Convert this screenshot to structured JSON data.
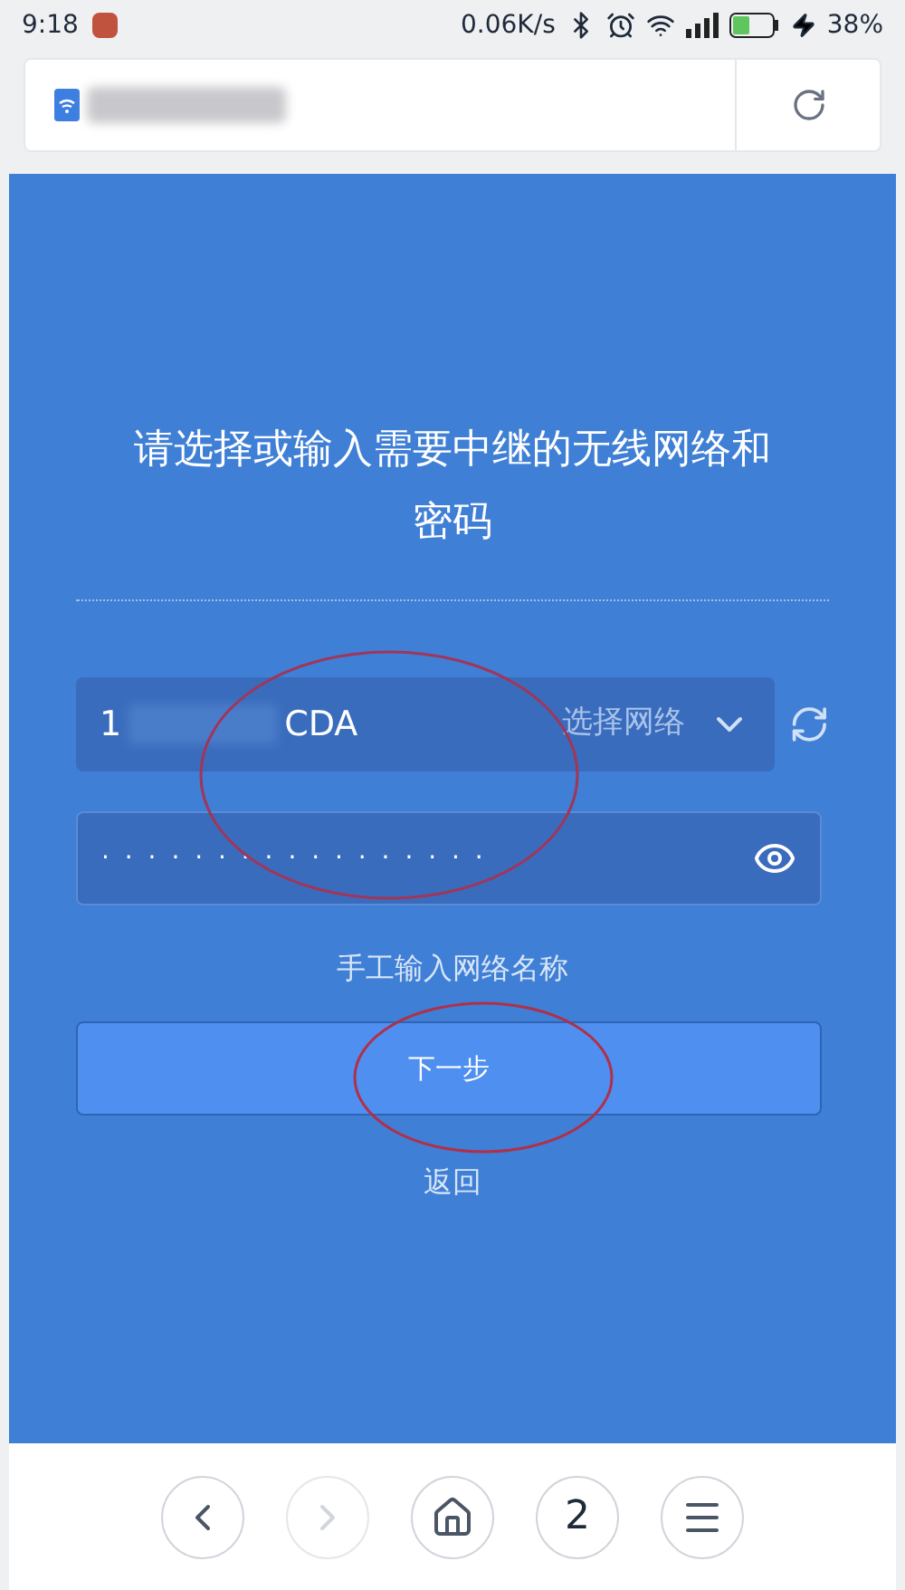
{
  "status_bar": {
    "time": "9:18",
    "speed": "0.06K/s",
    "battery": "38%"
  },
  "title": "请选择或输入需要中继的无线网络和密码",
  "network_field": {
    "value_start": "1",
    "value_end": "CDA",
    "action": "选择网络"
  },
  "password_field": {
    "mask": "· · · · · · · · · · · · · · · · ·"
  },
  "manual_link": "手工输入网络名称",
  "next_button": "下一步",
  "back_link": "返回",
  "bottom_nav": [
    {
      "kind": "back",
      "disabled": false
    },
    {
      "kind": "forward",
      "disabled": true
    },
    {
      "kind": "home",
      "disabled": false
    },
    {
      "kind": "tabs",
      "label": "2",
      "disabled": false
    },
    {
      "kind": "menu",
      "disabled": false
    }
  ]
}
